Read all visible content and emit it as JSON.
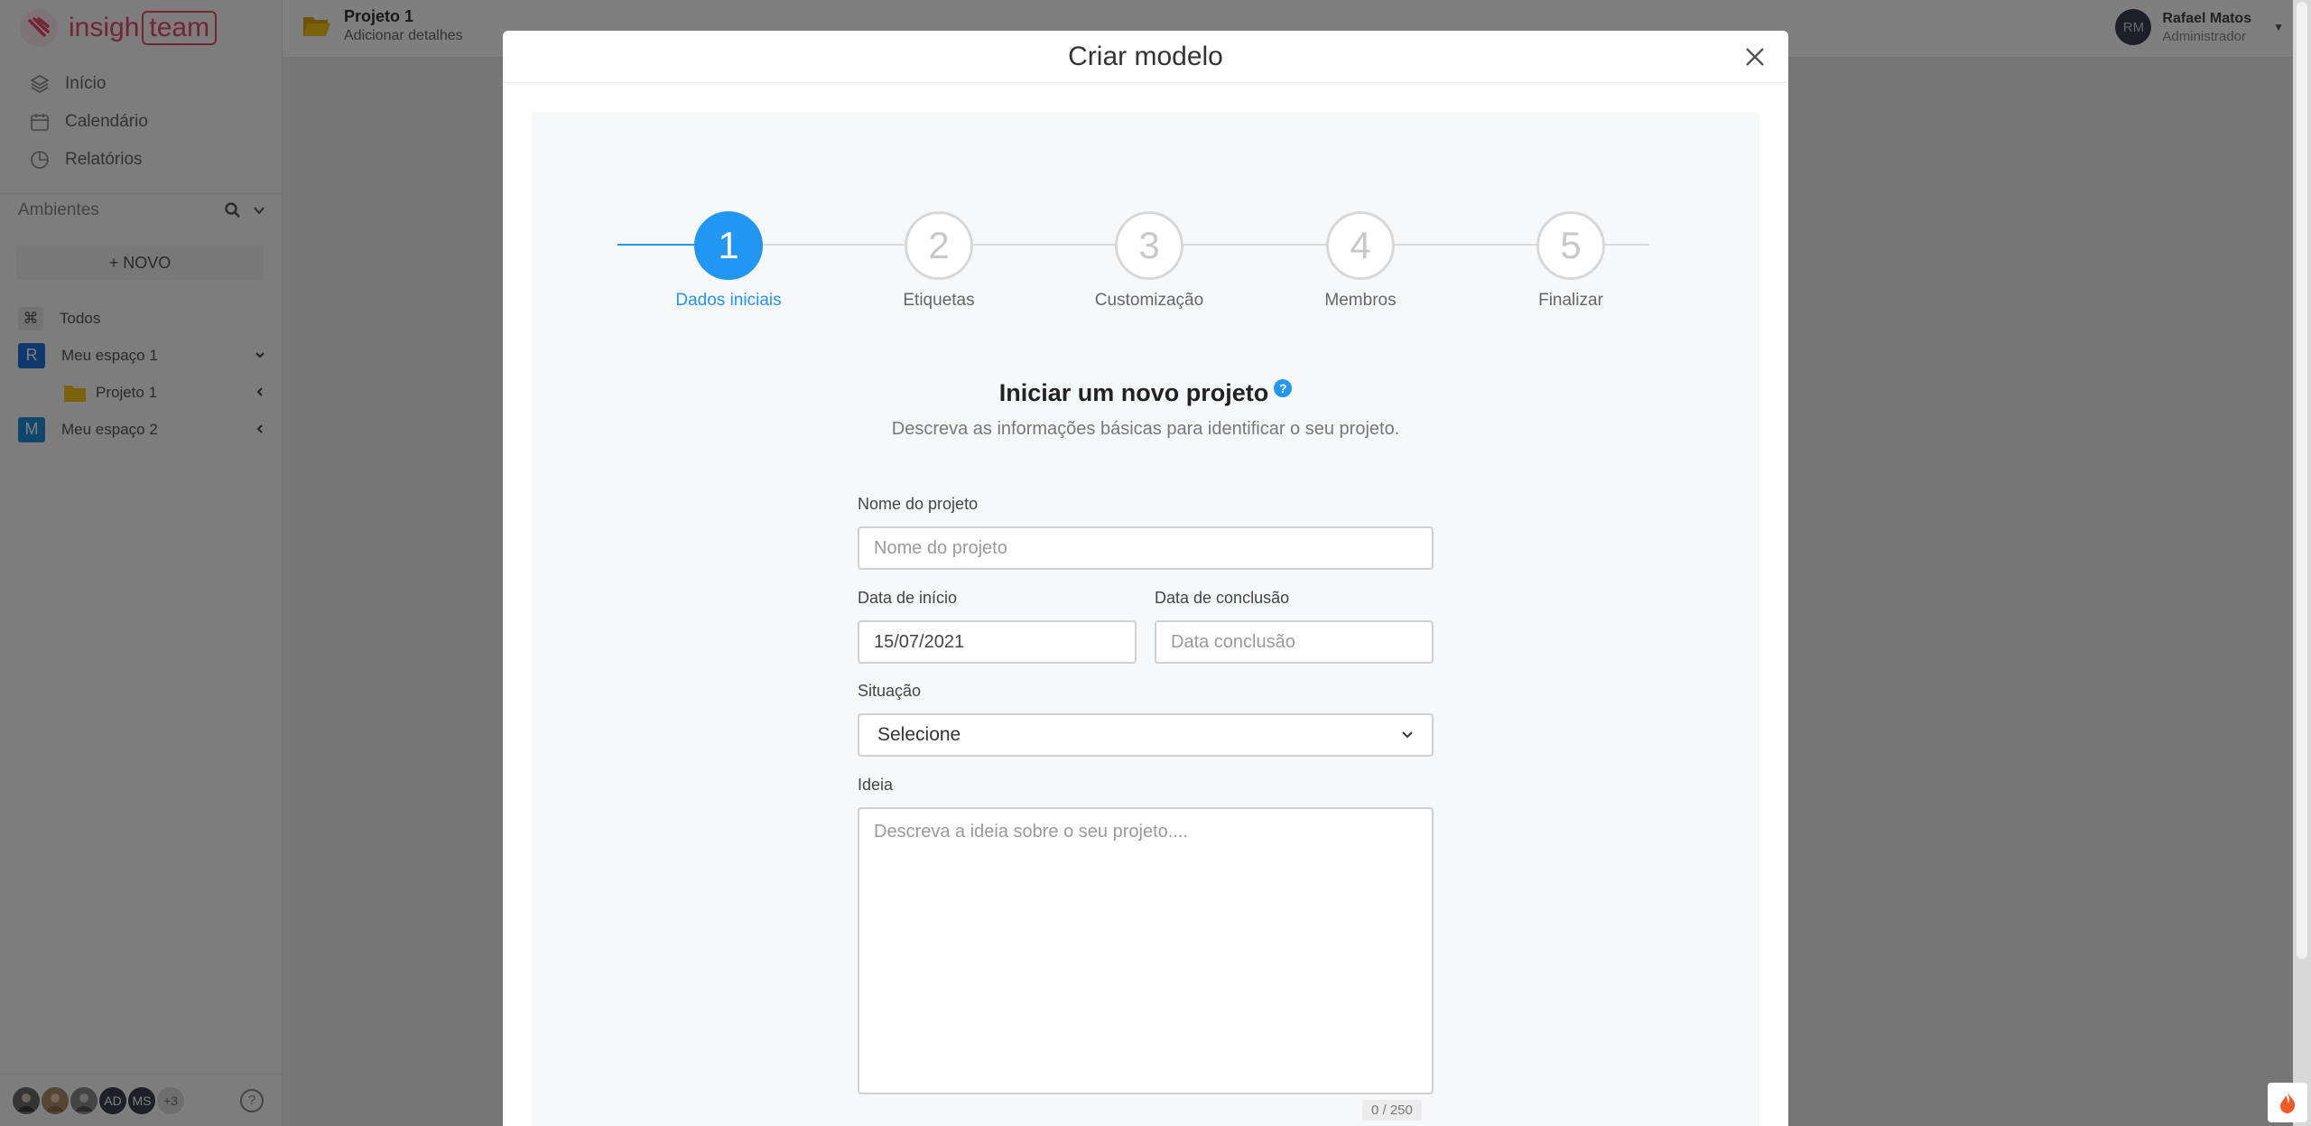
{
  "brand": {
    "name_part1": "insigh",
    "name_part2": "team",
    "accent": "#e64b6e"
  },
  "nav": [
    {
      "label": "Início",
      "icon": "layers-icon"
    },
    {
      "label": "Calendário",
      "icon": "calendar-icon"
    },
    {
      "label": "Relatórios",
      "icon": "chart-pie-icon"
    }
  ],
  "environments": {
    "title": "Ambientes",
    "new_button": "+ NOVO",
    "items": [
      {
        "label": "Todos",
        "badge": "⌘"
      },
      {
        "label": "Meu espaço 1",
        "badge": "R"
      },
      {
        "label": "Projeto 1"
      },
      {
        "label": "Meu espaço 2",
        "badge": "M"
      }
    ]
  },
  "footer": {
    "avatars": [
      "AD",
      "MS"
    ],
    "more": "+3"
  },
  "topbar": {
    "project_title": "Projeto 1",
    "project_subtitle": "Adicionar detalhes",
    "user_initials": "RM",
    "user_name": "Rafael Matos",
    "user_role": "Administrador"
  },
  "modal": {
    "title": "Criar modelo",
    "steps": [
      {
        "number": "1",
        "label": "Dados iniciais"
      },
      {
        "number": "2",
        "label": "Etiquetas"
      },
      {
        "number": "3",
        "label": "Customização"
      },
      {
        "number": "4",
        "label": "Membros"
      },
      {
        "number": "5",
        "label": "Finalizar"
      }
    ],
    "active_step": 1,
    "active_color": "#2196f3",
    "form": {
      "title": "Iniciar um novo projeto",
      "subtitle": "Descreva as informações básicas para identificar o seu projeto.",
      "name_label": "Nome do projeto",
      "name_placeholder": "Nome do projeto",
      "start_label": "Data de início",
      "start_value": "15/07/2021",
      "end_label": "Data de conclusão",
      "end_placeholder": "Data conclusão",
      "status_label": "Situação",
      "status_value": "Selecione",
      "idea_label": "Ideia",
      "idea_placeholder": "Descreva a ideia sobre o seu projeto....",
      "idea_counter": "0 / 250"
    }
  }
}
